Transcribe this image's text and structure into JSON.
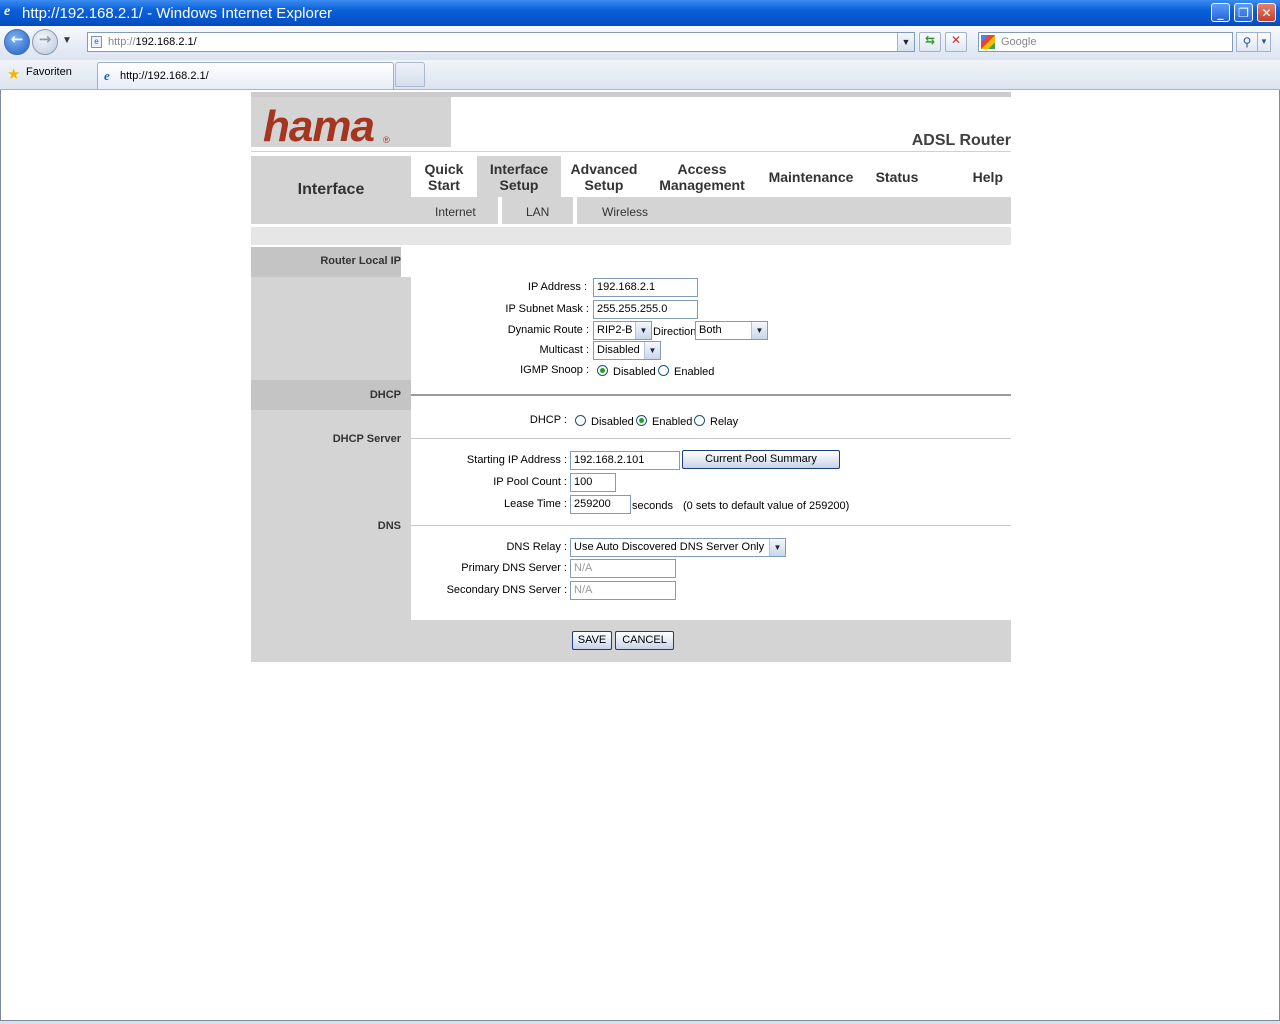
{
  "window": {
    "title": "http://192.168.2.1/ - Windows Internet Explorer",
    "minimize_glyph": "_",
    "restore_glyph": "❐",
    "close_glyph": "✕"
  },
  "toolbar": {
    "url_prefix": "http://",
    "url_host": "192.168.2.1/",
    "search_placeholder": "Google",
    "back_glyph": "←",
    "forward_glyph": "→"
  },
  "favorites": {
    "label": "Favoriten",
    "tab_title": "http://192.168.2.1/"
  },
  "router": {
    "logo": "hama",
    "logo_mark": "®",
    "product": "ADSL Router",
    "section_label": "Interface",
    "menu": [
      {
        "line1": "Quick",
        "line2": "Start"
      },
      {
        "line1": "Interface",
        "line2": "Setup"
      },
      {
        "line1": "Advanced",
        "line2": "Setup"
      },
      {
        "line1": "Access",
        "line2": "Management"
      },
      {
        "line1": "Maintenance",
        "line2": ""
      },
      {
        "line1": "Status",
        "line2": ""
      },
      {
        "line1": "Help",
        "line2": ""
      }
    ],
    "submenu": [
      "Internet",
      "LAN",
      "Wireless"
    ]
  },
  "lan": {
    "router_local_ip_label": "Router Local IP",
    "ip_address_label": "IP Address :",
    "ip_address": "192.168.2.1",
    "subnet_label": "IP Subnet Mask :",
    "subnet": "255.255.255.0",
    "dynamic_route_label": "Dynamic Route :",
    "dynamic_route": "RIP2-B",
    "direction_label": "Direction",
    "direction": "Both",
    "multicast_label": "Multicast :",
    "multicast": "Disabled",
    "igmp_label": "IGMP Snoop :",
    "igmp_disabled": "Disabled",
    "igmp_enabled": "Enabled"
  },
  "dhcp": {
    "section_label": "DHCP",
    "dhcp_label": "DHCP :",
    "opt_disabled": "Disabled",
    "opt_enabled": "Enabled",
    "opt_relay": "Relay",
    "server_label": "DHCP Server",
    "start_ip_label": "Starting IP Address :",
    "start_ip": "192.168.2.101",
    "pool_summary_button": "Current Pool Summary",
    "pool_count_label": "IP Pool Count :",
    "pool_count": "100",
    "lease_label": "Lease Time :",
    "lease": "259200",
    "lease_unit": "seconds",
    "lease_hint": "(0 sets to default value of 259200)"
  },
  "dns": {
    "section_label": "DNS",
    "relay_label": "DNS Relay :",
    "relay": "Use Auto Discovered DNS Server Only",
    "primary_label": "Primary DNS Server :",
    "primary": "N/A",
    "secondary_label": "Secondary DNS Server :",
    "secondary": "N/A"
  },
  "actions": {
    "save": "SAVE",
    "cancel": "CANCEL"
  }
}
